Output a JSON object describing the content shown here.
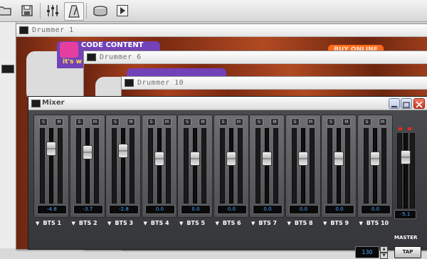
{
  "toolbar": {
    "buttons": [
      {
        "name": "open-folder-icon"
      },
      {
        "name": "save-icon"
      },
      {
        "name": "mixer-faders-icon"
      },
      {
        "name": "metronome-icon"
      },
      {
        "name": "drum-icon"
      },
      {
        "name": "play-icon"
      }
    ]
  },
  "windows": {
    "drummer1": {
      "title": "Drummer 1",
      "promo": "CODE CONTENT",
      "promo_sub": "it's w",
      "online_button": "BUY ONLINE"
    },
    "drummer6": {
      "title": "Drummer 6"
    },
    "drummer10": {
      "title": "Drummer 10"
    }
  },
  "mixer": {
    "title": "Mixer",
    "channels": [
      {
        "name": "BTS 1",
        "value": "-4.8",
        "fader_level": 0.78
      },
      {
        "name": "BTS 2",
        "value": "-3.7",
        "fader_level": 0.72
      },
      {
        "name": "BTS 3",
        "value": "-2.8",
        "fader_level": 0.74
      },
      {
        "name": "BTS 4",
        "value": "0.0",
        "fader_level": 0.62
      },
      {
        "name": "BTS 5",
        "value": "0.0",
        "fader_level": 0.62
      },
      {
        "name": "BTS 6",
        "value": "0.0",
        "fader_level": 0.62
      },
      {
        "name": "BTS 7",
        "value": "0.0",
        "fader_level": 0.62
      },
      {
        "name": "BTS 8",
        "value": "0.0",
        "fader_level": 0.62
      },
      {
        "name": "BTS 9",
        "value": "0.0",
        "fader_level": 0.62
      },
      {
        "name": "BTS 10",
        "value": "0.0",
        "fader_level": 0.62
      }
    ],
    "master": {
      "label": "MASTER",
      "value": "-5.1",
      "fader_level": 0.72
    },
    "tempo": "130",
    "tap_label": "TAP",
    "mute_label": "M",
    "solo_label": "S"
  },
  "colors": {
    "value_text": "#49a6ff",
    "wood": "#a8401c",
    "promo": "#7342b8",
    "accent_orange": "#ff6a1a",
    "clip_led": "#e8281d"
  }
}
